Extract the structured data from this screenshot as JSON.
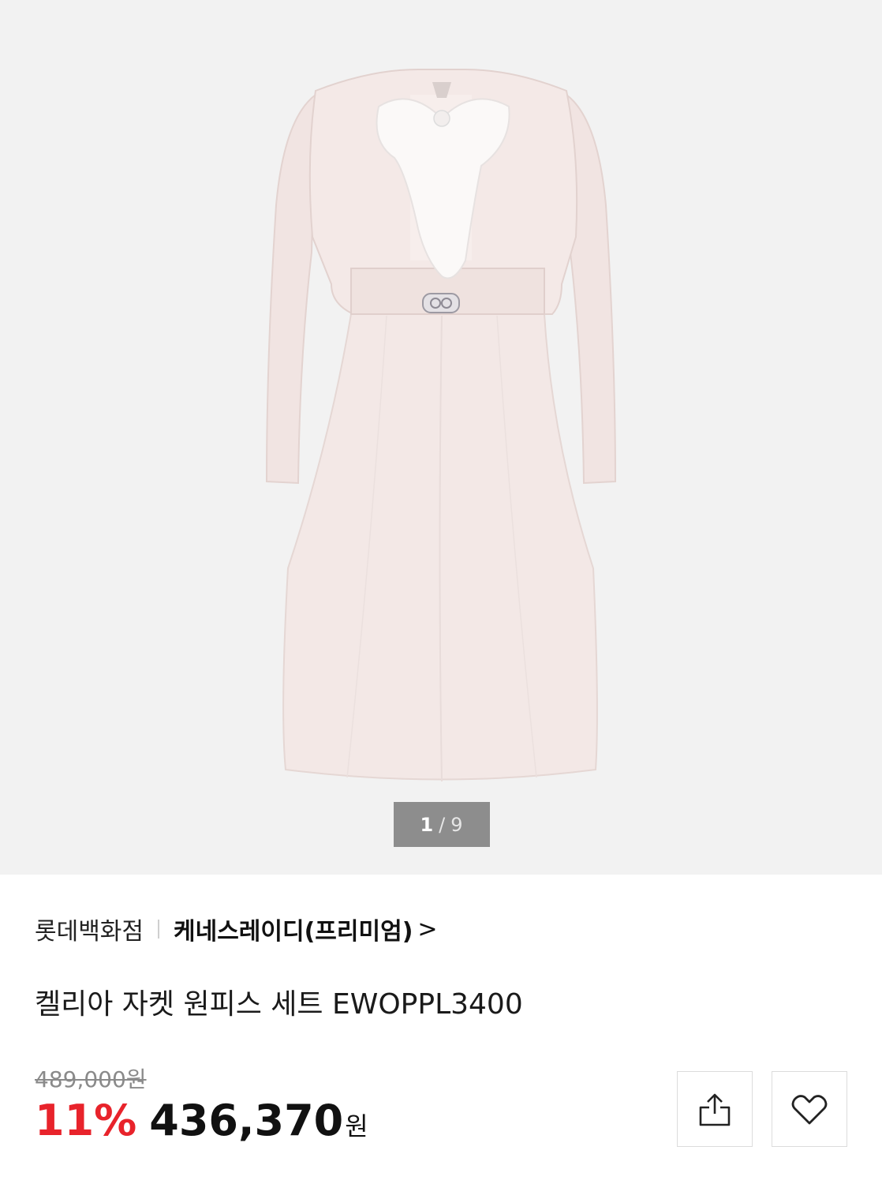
{
  "gallery": {
    "pager": {
      "current": "1",
      "separator": "/",
      "total": "9"
    }
  },
  "breadcrumb": {
    "store": "롯데백화점",
    "brand": "케네스레이디(프리미엄)",
    "chevron": ">"
  },
  "product": {
    "title": "켈리아 자켓 원피스 세트 EWOPPL3400",
    "original_price": "489,000원",
    "discount_rate": "11%",
    "sale_price": "436,370",
    "currency": "원"
  },
  "icons": {
    "share": "share-icon",
    "wish": "heart-icon"
  },
  "colors": {
    "discount": "#e8232b",
    "background_gallery": "#f2f2f2"
  }
}
